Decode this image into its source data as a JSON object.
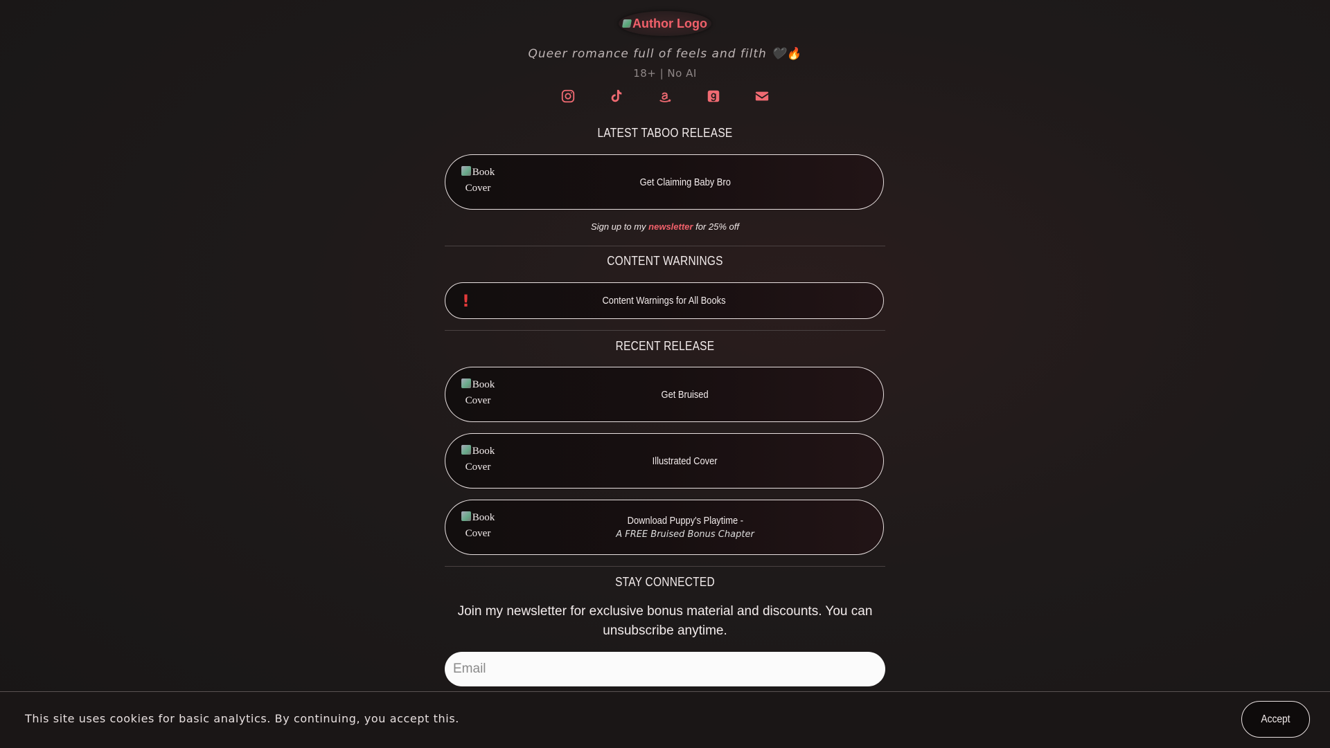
{
  "header": {
    "logo_alt": "Author Logo",
    "tagline": "Queer romance full of feels and filth 🖤🔥",
    "subtag": "18+ | No AI"
  },
  "socials": [
    {
      "name": "instagram-icon"
    },
    {
      "name": "tiktok-icon"
    },
    {
      "name": "amazon-icon"
    },
    {
      "name": "goodreads-icon"
    },
    {
      "name": "email-icon"
    }
  ],
  "sections": {
    "latest": {
      "title": "LATEST TABOO RELEASE",
      "card_label": "Get Claiming Baby Bro",
      "cover_alt_1": "Book",
      "cover_alt_2": "Cover"
    },
    "promo": {
      "prefix": "Sign up to my ",
      "link": "newsletter",
      "suffix": " for 25% off"
    },
    "warnings": {
      "title": "CONTENT WARNINGS",
      "card_label": "Content Warnings for All Books",
      "icon": "!"
    },
    "recent": {
      "title": "RECENT RELEASE",
      "cards": [
        {
          "label": "Get Bruised",
          "sub": ""
        },
        {
          "label": "Illustrated Cover",
          "sub": ""
        },
        {
          "label": "Download Puppy's Playtime -",
          "sub": "A FREE Bruised Bonus Chapter"
        }
      ],
      "cover_alt_1": "Book",
      "cover_alt_2": "Cover"
    },
    "connect": {
      "title": "STAY CONNECTED",
      "text": "Join my newsletter for exclusive bonus material and discounts. You can unsubscribe anytime.",
      "email_placeholder": "Email"
    }
  },
  "cookie": {
    "message": "This site uses cookies for basic analytics. By continuing, you accept this.",
    "accept_label": "Accept"
  },
  "colors": {
    "accent": "#f0606a",
    "background": "#1c1818",
    "warning": "#e23a3a"
  }
}
